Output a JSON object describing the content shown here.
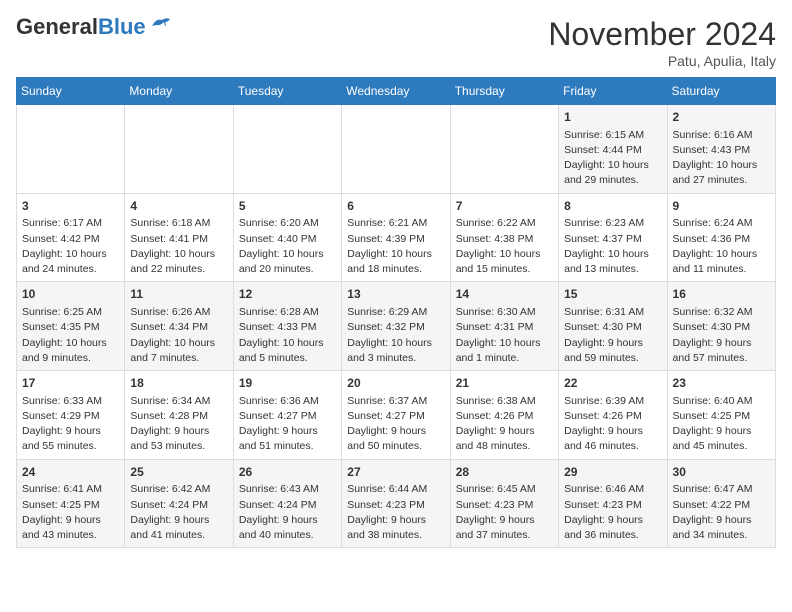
{
  "logo": {
    "general": "General",
    "blue": "Blue"
  },
  "header": {
    "month": "November 2024",
    "location": "Patu, Apulia, Italy"
  },
  "weekdays": [
    "Sunday",
    "Monday",
    "Tuesday",
    "Wednesday",
    "Thursday",
    "Friday",
    "Saturday"
  ],
  "weeks": [
    [
      {
        "day": "",
        "info": ""
      },
      {
        "day": "",
        "info": ""
      },
      {
        "day": "",
        "info": ""
      },
      {
        "day": "",
        "info": ""
      },
      {
        "day": "",
        "info": ""
      },
      {
        "day": "1",
        "info": "Sunrise: 6:15 AM\nSunset: 4:44 PM\nDaylight: 10 hours and 29 minutes."
      },
      {
        "day": "2",
        "info": "Sunrise: 6:16 AM\nSunset: 4:43 PM\nDaylight: 10 hours and 27 minutes."
      }
    ],
    [
      {
        "day": "3",
        "info": "Sunrise: 6:17 AM\nSunset: 4:42 PM\nDaylight: 10 hours and 24 minutes."
      },
      {
        "day": "4",
        "info": "Sunrise: 6:18 AM\nSunset: 4:41 PM\nDaylight: 10 hours and 22 minutes."
      },
      {
        "day": "5",
        "info": "Sunrise: 6:20 AM\nSunset: 4:40 PM\nDaylight: 10 hours and 20 minutes."
      },
      {
        "day": "6",
        "info": "Sunrise: 6:21 AM\nSunset: 4:39 PM\nDaylight: 10 hours and 18 minutes."
      },
      {
        "day": "7",
        "info": "Sunrise: 6:22 AM\nSunset: 4:38 PM\nDaylight: 10 hours and 15 minutes."
      },
      {
        "day": "8",
        "info": "Sunrise: 6:23 AM\nSunset: 4:37 PM\nDaylight: 10 hours and 13 minutes."
      },
      {
        "day": "9",
        "info": "Sunrise: 6:24 AM\nSunset: 4:36 PM\nDaylight: 10 hours and 11 minutes."
      }
    ],
    [
      {
        "day": "10",
        "info": "Sunrise: 6:25 AM\nSunset: 4:35 PM\nDaylight: 10 hours and 9 minutes."
      },
      {
        "day": "11",
        "info": "Sunrise: 6:26 AM\nSunset: 4:34 PM\nDaylight: 10 hours and 7 minutes."
      },
      {
        "day": "12",
        "info": "Sunrise: 6:28 AM\nSunset: 4:33 PM\nDaylight: 10 hours and 5 minutes."
      },
      {
        "day": "13",
        "info": "Sunrise: 6:29 AM\nSunset: 4:32 PM\nDaylight: 10 hours and 3 minutes."
      },
      {
        "day": "14",
        "info": "Sunrise: 6:30 AM\nSunset: 4:31 PM\nDaylight: 10 hours and 1 minute."
      },
      {
        "day": "15",
        "info": "Sunrise: 6:31 AM\nSunset: 4:30 PM\nDaylight: 9 hours and 59 minutes."
      },
      {
        "day": "16",
        "info": "Sunrise: 6:32 AM\nSunset: 4:30 PM\nDaylight: 9 hours and 57 minutes."
      }
    ],
    [
      {
        "day": "17",
        "info": "Sunrise: 6:33 AM\nSunset: 4:29 PM\nDaylight: 9 hours and 55 minutes."
      },
      {
        "day": "18",
        "info": "Sunrise: 6:34 AM\nSunset: 4:28 PM\nDaylight: 9 hours and 53 minutes."
      },
      {
        "day": "19",
        "info": "Sunrise: 6:36 AM\nSunset: 4:27 PM\nDaylight: 9 hours and 51 minutes."
      },
      {
        "day": "20",
        "info": "Sunrise: 6:37 AM\nSunset: 4:27 PM\nDaylight: 9 hours and 50 minutes."
      },
      {
        "day": "21",
        "info": "Sunrise: 6:38 AM\nSunset: 4:26 PM\nDaylight: 9 hours and 48 minutes."
      },
      {
        "day": "22",
        "info": "Sunrise: 6:39 AM\nSunset: 4:26 PM\nDaylight: 9 hours and 46 minutes."
      },
      {
        "day": "23",
        "info": "Sunrise: 6:40 AM\nSunset: 4:25 PM\nDaylight: 9 hours and 45 minutes."
      }
    ],
    [
      {
        "day": "24",
        "info": "Sunrise: 6:41 AM\nSunset: 4:25 PM\nDaylight: 9 hours and 43 minutes."
      },
      {
        "day": "25",
        "info": "Sunrise: 6:42 AM\nSunset: 4:24 PM\nDaylight: 9 hours and 41 minutes."
      },
      {
        "day": "26",
        "info": "Sunrise: 6:43 AM\nSunset: 4:24 PM\nDaylight: 9 hours and 40 minutes."
      },
      {
        "day": "27",
        "info": "Sunrise: 6:44 AM\nSunset: 4:23 PM\nDaylight: 9 hours and 38 minutes."
      },
      {
        "day": "28",
        "info": "Sunrise: 6:45 AM\nSunset: 4:23 PM\nDaylight: 9 hours and 37 minutes."
      },
      {
        "day": "29",
        "info": "Sunrise: 6:46 AM\nSunset: 4:23 PM\nDaylight: 9 hours and 36 minutes."
      },
      {
        "day": "30",
        "info": "Sunrise: 6:47 AM\nSunset: 4:22 PM\nDaylight: 9 hours and 34 minutes."
      }
    ]
  ]
}
